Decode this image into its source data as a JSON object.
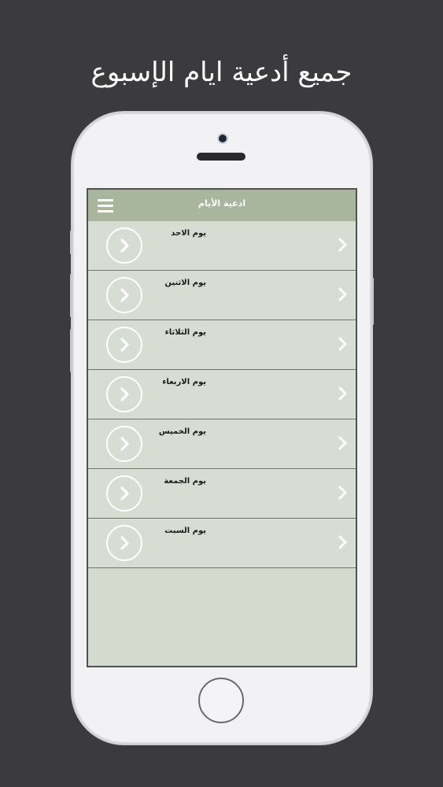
{
  "headline": "جميع أدعية ايام الإسبوع",
  "app": {
    "title": "ادعية الأيام",
    "menu_icon": "hamburger-menu-icon"
  },
  "days": [
    {
      "label": "يوم الاحد"
    },
    {
      "label": "يوم الاثنين"
    },
    {
      "label": "يوم الثلاثاء"
    },
    {
      "label": "يوم الاربعاء"
    },
    {
      "label": "يوم الخميس"
    },
    {
      "label": "يوم الجمعة"
    },
    {
      "label": "يوم السبت"
    }
  ],
  "colors": {
    "background": "#3b3a3c",
    "navbar": "#a7b69c",
    "list_bg": "#d7ddd2",
    "divider": "#6f736c"
  }
}
